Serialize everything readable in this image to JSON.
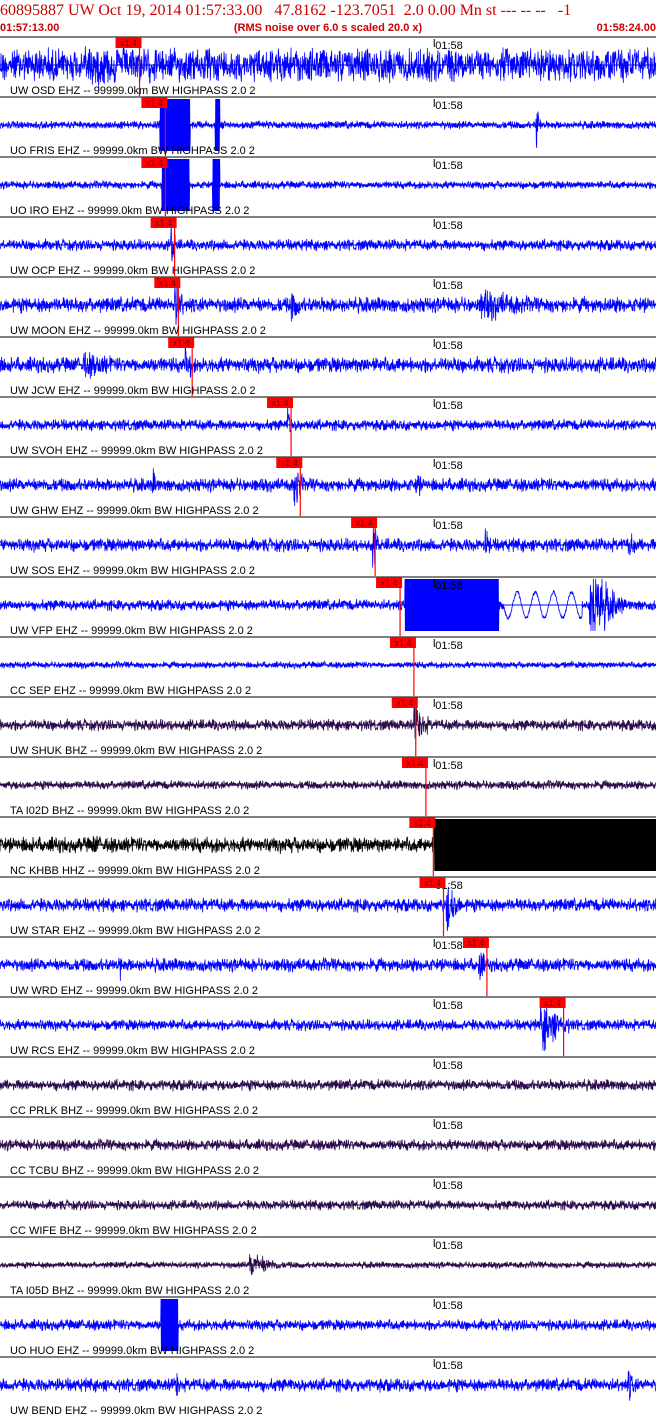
{
  "header": {
    "title": "60895887 UW Oct 19, 2014 01:57:33.00   47.8162 -123.7051  2.0 0.00 Mn st --- -- --   -1",
    "start_time": "01:57:13.00",
    "end_time": "01:58:24.00",
    "noise_note": "(RMS noise over 6.0 s scaled 20.0 x)"
  },
  "colors": {
    "trace_blue": "#0000ff",
    "trace_black": "#000000",
    "trace_purple": "#2a0a4a",
    "pick_red": "#ff0000",
    "header_red": "#cc0000",
    "divider": "#000000"
  },
  "chart_data": {
    "type": "line",
    "title": "60895887 UW Oct 19, 2014 01:57:33.00   47.8162 -123.7051  2.0 0.00 Mn st --- -- --   -1",
    "x_range": [
      "01:57:13.00",
      "01:58:24.00"
    ],
    "x_range_seconds": [
      0,
      71
    ],
    "minute_tick_label": "01:58",
    "minute_tick_seconds": 47,
    "pick_label": "x1.4",
    "traces": [
      {
        "label": "UW OSD EHZ -- 99999.0km BW  HIGHPASS  2.0  2",
        "color": "blue",
        "pick_s": 15.1,
        "amp": 0.75,
        "bursts": [
          {
            "s": 9,
            "e": 71,
            "a": 1.0
          }
        ]
      },
      {
        "label": "UO FRIS EHZ -- 99999.0km BW  HIGHPASS  2.0  2",
        "color": "blue",
        "pick_s": 17.9,
        "amp": 0.18,
        "bursts": [
          {
            "s": 17.3,
            "e": 20.6,
            "a": 4.0,
            "clip": true
          },
          {
            "s": 23.3,
            "e": 23.8,
            "a": 4.0,
            "clip": true
          },
          {
            "s": 58.0,
            "e": 58.6,
            "a": 2.0
          }
        ]
      },
      {
        "label": "UO IRO EHZ -- 99999.0km BW  HIGHPASS  2.0  2",
        "color": "blue",
        "pick_s": 17.9,
        "amp": 0.18,
        "bursts": [
          {
            "s": 17.5,
            "e": 20.5,
            "a": 4.0,
            "clip": true
          },
          {
            "s": 23.0,
            "e": 23.8,
            "a": 4.0,
            "clip": true
          }
        ]
      },
      {
        "label": "UW OCP EHZ -- 99999.0km BW  HIGHPASS  2.0  2",
        "color": "blue",
        "pick_s": 18.9,
        "amp": 0.25,
        "bursts": [
          {
            "s": 18.5,
            "e": 19.5,
            "a": 1.5
          }
        ]
      },
      {
        "label": "UW MOON EHZ -- 99999.0km BW  HIGHPASS  2.0  2",
        "color": "blue",
        "pick_s": 19.3,
        "amp": 0.35,
        "bursts": [
          {
            "s": 18.9,
            "e": 20.5,
            "a": 1.6
          },
          {
            "s": 31.5,
            "e": 34.5,
            "a": 0.9
          },
          {
            "s": 52,
            "e": 67,
            "a": 0.8
          }
        ]
      },
      {
        "label": "UW JCW EHZ -- 99999.0km BW  HIGHPASS  2.0  2",
        "color": "blue",
        "pick_s": 20.8,
        "amp": 0.35,
        "bursts": [
          {
            "s": 9,
            "e": 20,
            "a": 0.7
          },
          {
            "s": 20,
            "e": 21.5,
            "a": 1.4
          }
        ]
      },
      {
        "label": "UW SVOH EHZ -- 99999.0km BW  HIGHPASS  2.0  2",
        "color": "blue",
        "pick_s": 31.5,
        "amp": 0.25,
        "bursts": [
          {
            "s": 31.1,
            "e": 32.0,
            "a": 1.4
          }
        ]
      },
      {
        "label": "UW GHW EHZ -- 99999.0km BW  HIGHPASS  2.0  2",
        "color": "blue",
        "pick_s": 32.5,
        "amp": 0.3,
        "bursts": [
          {
            "s": 31.8,
            "e": 33.5,
            "a": 1.4
          },
          {
            "s": 16.5,
            "e": 17.5,
            "a": 0.9
          },
          {
            "s": 45,
            "e": 46.5,
            "a": 0.9
          }
        ]
      },
      {
        "label": "UW SOS EHZ -- 99999.0km BW  HIGHPASS  2.0  2",
        "color": "blue",
        "pick_s": 40.6,
        "amp": 0.3,
        "bursts": [
          {
            "s": 40.3,
            "e": 41.5,
            "a": 1.3
          },
          {
            "s": 52.5,
            "e": 54.5,
            "a": 0.8
          },
          {
            "s": 68,
            "e": 70,
            "a": 0.8
          }
        ]
      },
      {
        "label": "UW VFP EHZ -- 99999.0km BW  HIGHPASS  2.0  2",
        "color": "blue",
        "pick_s": 43.3,
        "amp": 0.25,
        "bursts": [
          {
            "s": 43.8,
            "e": 54.0,
            "a": 4.0,
            "clip": true
          },
          {
            "s": 63.8,
            "e": 67.5,
            "a": 3.0
          }
        ],
        "sine": {
          "s": 54.5,
          "e": 63.0,
          "a": 0.5
        }
      },
      {
        "label": "CC SEP EHZ -- 99999.0km BW  HIGHPASS  2.0  2",
        "color": "blue",
        "pick_s": 44.8,
        "amp": 0.15,
        "bursts": []
      },
      {
        "label": "UW SHUK BHZ -- 99999.0km BW  HIGHPASS  2.0  2",
        "color": "purple",
        "pick_s": 45.0,
        "amp": 0.25,
        "bursts": [
          {
            "s": 44.8,
            "e": 47.5,
            "a": 1.3
          }
        ]
      },
      {
        "label": "TA I02D BHZ -- 99999.0km BW  HIGHPASS  2.0  2",
        "color": "purple",
        "pick_s": 46.1,
        "amp": 0.2,
        "bursts": []
      },
      {
        "label": "NC KHBB HHZ -- 99999.0km BW  HIGHPASS  2.0  2",
        "color": "black",
        "pick_s": 46.9,
        "amp": 0.35,
        "bursts": [
          {
            "s": 47,
            "e": 71,
            "a": 1.6,
            "clip": true
          },
          {
            "s": 10,
            "e": 14,
            "a": 0.6
          }
        ]
      },
      {
        "label": "UW STAR EHZ -- 99999.0km BW  HIGHPASS  2.0  2",
        "color": "blue",
        "pick_s": 48.0,
        "amp": 0.3,
        "bursts": [
          {
            "s": 48.3,
            "e": 51.0,
            "a": 1.5
          }
        ]
      },
      {
        "label": "UW WRD EHZ -- 99999.0km BW  HIGHPASS  2.0  2",
        "color": "blue",
        "pick_s": 52.7,
        "amp": 0.3,
        "bursts": [
          {
            "s": 51.8,
            "e": 53.0,
            "a": 1.3
          },
          {
            "s": 13,
            "e": 13.6,
            "a": 0.9
          }
        ]
      },
      {
        "label": "UW RCS EHZ -- 99999.0km BW  HIGHPASS  2.0  2",
        "color": "blue",
        "pick_s": 61.0,
        "amp": 0.25,
        "bursts": [
          {
            "s": 58.5,
            "e": 63.0,
            "a": 1.5
          }
        ]
      },
      {
        "label": "CC PRLK BHZ -- 99999.0km BW  HIGHPASS  2.0  2",
        "color": "purple",
        "pick_s": null,
        "amp": 0.25,
        "bursts": []
      },
      {
        "label": "CC TCBU BHZ -- 99999.0km BW  HIGHPASS  2.0  2",
        "color": "purple",
        "pick_s": null,
        "amp": 0.25,
        "bursts": []
      },
      {
        "label": "CC WIFE BHZ -- 99999.0km BW  HIGHPASS  2.0  2",
        "color": "purple",
        "pick_s": null,
        "amp": 0.22,
        "bursts": []
      },
      {
        "label": "TA I05D BHZ -- 99999.0km BW  HIGHPASS  2.0  2",
        "color": "purple",
        "pick_s": null,
        "amp": 0.15,
        "bursts": [
          {
            "s": 27,
            "e": 32,
            "a": 0.8
          }
        ]
      },
      {
        "label": "UO HUO EHZ -- 99999.0km BW  HIGHPASS  2.0  2",
        "color": "blue",
        "pick_s": null,
        "amp": 0.25,
        "bursts": [
          {
            "s": 17.4,
            "e": 19.3,
            "a": 4.0,
            "clip": true
          }
        ]
      },
      {
        "label": "UW BEND EHZ -- 99999.0km BW  HIGHPASS  2.0  2",
        "color": "blue",
        "pick_s": null,
        "amp": 0.3,
        "bursts": [
          {
            "s": 19,
            "e": 20,
            "a": 1.1
          },
          {
            "s": 68,
            "e": 70,
            "a": 0.9
          }
        ]
      }
    ]
  }
}
